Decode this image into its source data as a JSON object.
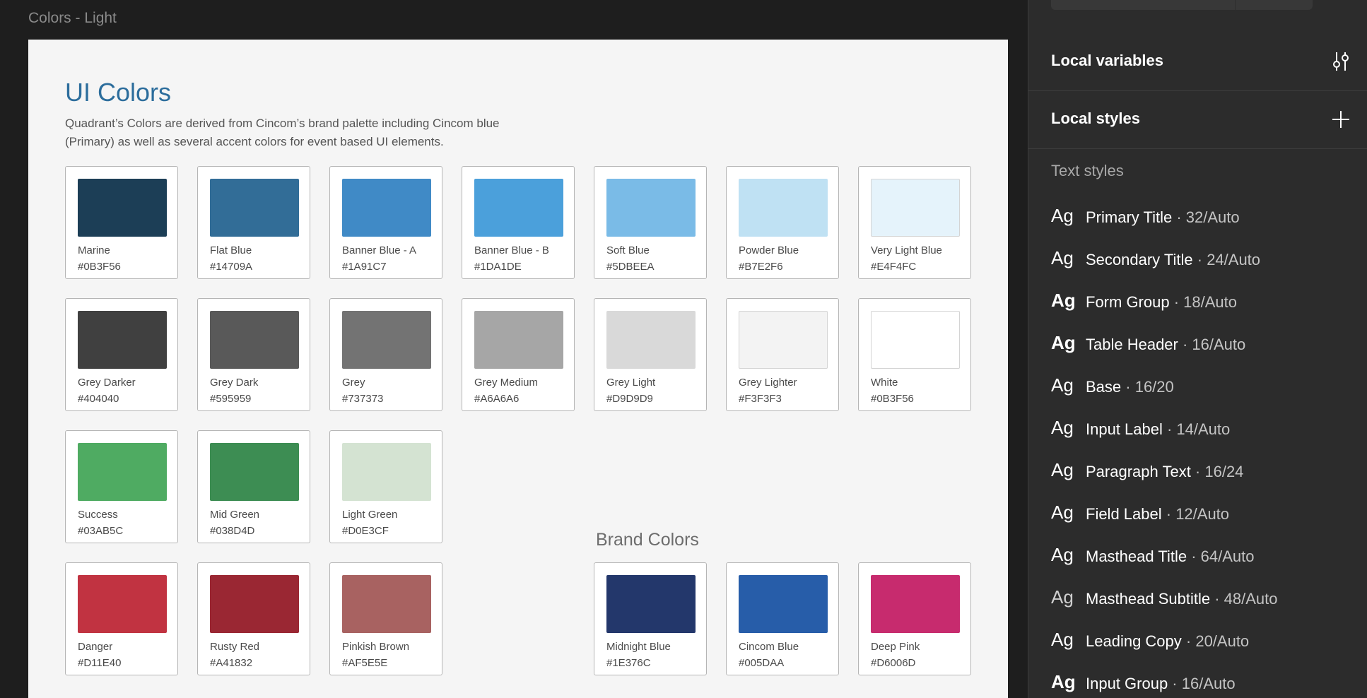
{
  "canvas": {
    "frame_label": "Colors - Light",
    "title": "UI Colors",
    "description": "Quadrant’s Colors are derived from Cincom’s brand palette including Cincom blue (Primary) as well as several accent colors for event based UI elements.",
    "swatches": [
      {
        "name": "Marine",
        "hex": "#0B3F56",
        "color": "#1c3e56"
      },
      {
        "name": "Flat Blue",
        "hex": "#14709A",
        "color": "#326d97"
      },
      {
        "name": "Banner Blue - A",
        "hex": "#1A91C7",
        "color": "#408ac6"
      },
      {
        "name": "Banner Blue - B",
        "hex": "#1DA1DE",
        "color": "#4ba0db"
      },
      {
        "name": "Soft Blue",
        "hex": "#5DBEEA",
        "color": "#7abbe7"
      },
      {
        "name": "Powder Blue",
        "hex": "#B7E2F6",
        "color": "#bfe1f3"
      },
      {
        "name": "Very Light Blue",
        "hex": "#E4F4FC",
        "color": "#e5f3fb"
      },
      {
        "name": "Grey Darker",
        "hex": "#404040",
        "color": "#404040"
      },
      {
        "name": "Grey Dark",
        "hex": "#595959",
        "color": "#595959"
      },
      {
        "name": "Grey",
        "hex": "#737373",
        "color": "#737373"
      },
      {
        "name": "Grey Medium",
        "hex": "#A6A6A6",
        "color": "#a6a6a6"
      },
      {
        "name": "Grey Light",
        "hex": "#D9D9D9",
        "color": "#d9d9d9"
      },
      {
        "name": "Grey Lighter",
        "hex": "#F3F3F3",
        "color": "#f3f3f3"
      },
      {
        "name": "White",
        "hex": "#0B3F56",
        "color": "#ffffff"
      },
      {
        "name": "Success",
        "hex": "#03AB5C",
        "color": "#4fab62"
      },
      {
        "name": "Mid Green",
        "hex": "#038D4D",
        "color": "#3d8d53"
      },
      {
        "name": "Light Green",
        "hex": "#D0E3CF",
        "color": "#d4e3d2"
      },
      {
        "name": "Danger",
        "hex": "#D11E40",
        "color": "#c13341"
      },
      {
        "name": "Rusty Red",
        "hex": "#A41832",
        "color": "#9a2733"
      },
      {
        "name": "Pinkish Brown",
        "hex": "#AF5E5E",
        "color": "#a86261"
      }
    ],
    "brand_heading": "Brand Colors",
    "brand_swatches": [
      {
        "name": "Midnight Blue",
        "hex": "#1E376C",
        "color": "#23376b"
      },
      {
        "name": "Cincom Blue",
        "hex": "#005DAA",
        "color": "#275da9"
      },
      {
        "name": "Deep Pink",
        "hex": "#D6006D",
        "color": "#c72b6e"
      }
    ]
  },
  "panel": {
    "local_variables": "Local variables",
    "local_styles": "Local styles",
    "text_styles_heading": "Text styles",
    "icons": {
      "variables": "sliders-icon",
      "styles": "plus-icon"
    },
    "text_styles": [
      {
        "ag": "Ag",
        "name": "Primary Title",
        "meta": " · 32/Auto",
        "weight": "normal"
      },
      {
        "ag": "Ag",
        "name": "Secondary Title",
        "meta": " · 24/Auto",
        "weight": "normal"
      },
      {
        "ag": "Ag",
        "name": "Form Group",
        "meta": " · 18/Auto",
        "weight": "bold"
      },
      {
        "ag": "Ag",
        "name": "Table Header",
        "meta": " · 16/Auto",
        "weight": "bold"
      },
      {
        "ag": "Ag",
        "name": "Base",
        "meta": " · 16/20",
        "weight": "normal"
      },
      {
        "ag": "Ag",
        "name": "Input Label",
        "meta": " · 14/Auto",
        "weight": "normal"
      },
      {
        "ag": "Ag",
        "name": "Paragraph Text",
        "meta": " · 16/24",
        "weight": "normal"
      },
      {
        "ag": "Ag",
        "name": "Field Label",
        "meta": " · 12/Auto",
        "weight": "normal"
      },
      {
        "ag": "Ag",
        "name": "Masthead Title",
        "meta": " · 64/Auto",
        "weight": "normal"
      },
      {
        "ag": "Ag",
        "name": "Masthead Subtitle",
        "meta": " · 48/Auto",
        "weight": "light"
      },
      {
        "ag": "Ag",
        "name": "Leading Copy",
        "meta": " · 20/Auto",
        "weight": "normal"
      },
      {
        "ag": "Ag",
        "name": "Input Group",
        "meta": " · 16/Auto",
        "weight": "bold"
      }
    ]
  }
}
